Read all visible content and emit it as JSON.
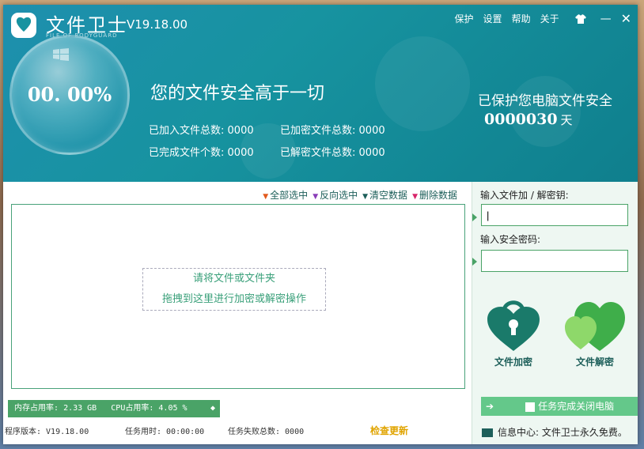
{
  "header": {
    "app_title": "文件卫士",
    "app_subtitle": "FILE OF BODYGUARD",
    "version": "V19.18.00",
    "menu": [
      "保护",
      "设置",
      "帮助",
      "关于"
    ],
    "gauge_percent": "00. 00%",
    "slogan": "您的文件安全高于一切",
    "stats": {
      "added_label": "已加入文件总数:",
      "added_value": "0000",
      "encrypted_label": "已加密文件总数:",
      "encrypted_value": "0000",
      "completed_label": "已完成文件个数:",
      "completed_value": "0000",
      "decrypted_label": "已解密文件总数:",
      "decrypted_value": "0000"
    },
    "protect_text": "已保护您电脑文件安全",
    "days_count": "0000030",
    "days_unit": "天"
  },
  "toolbar": {
    "select_all": "全部选中",
    "invert_select": "反向选中",
    "clear_data": "清空数据",
    "delete_data": "删除数据"
  },
  "drop_zone": {
    "line1": "请将文件或文件夹",
    "line2": "拖拽到这里进行加密或解密操作"
  },
  "status": {
    "memory_label": "内存占用率:",
    "memory_value": "2.33 GB",
    "cpu_label": "CPU占用率:",
    "cpu_value": "4.05 %"
  },
  "bottom": {
    "program_version": "程序版本: V19.18.00",
    "task_time": "任务用时:  00:00:00",
    "task_failed": "任务失败总数: 0000",
    "check_update": "检查更新"
  },
  "side": {
    "key_label": "输入文件加 / 解密钥:",
    "key_value": "|",
    "password_label": "输入安全密码:",
    "password_value": "",
    "encrypt_label": "文件加密",
    "decrypt_label": "文件解密",
    "shutdown_label": "任务完成关闭电脑",
    "info_text": "信息中心: 文件卫士永久免费。"
  },
  "colors": {
    "header_bg": "#1793a0",
    "accent_green": "#4aa367",
    "encrypt_heart": "#1a7a6a",
    "decrypt_heart": "#3fae4a",
    "update_text": "#e0a400"
  },
  "icons": [
    "logo-icon",
    "skin-icon",
    "minimize-icon",
    "close-icon",
    "windows-icon",
    "lock-heart-icon",
    "double-heart-icon",
    "mail-icon",
    "arrow-back-icon"
  ]
}
